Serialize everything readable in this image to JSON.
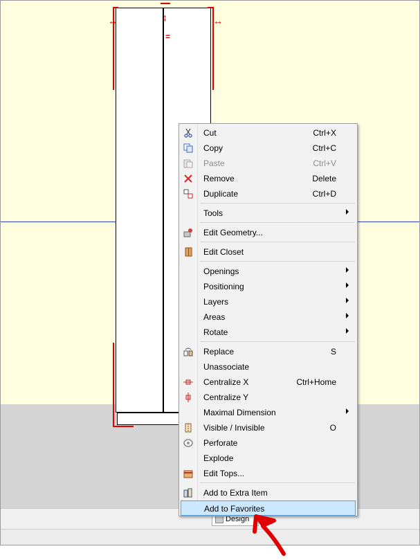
{
  "status": {
    "design_tab_label": "Design"
  },
  "menu": {
    "items": [
      {
        "id": "cut",
        "label": "Cut",
        "shortcut": "Ctrl+X",
        "icon": "scissors-icon"
      },
      {
        "id": "copy",
        "label": "Copy",
        "shortcut": "Ctrl+C",
        "icon": "copy-icon"
      },
      {
        "id": "paste",
        "label": "Paste",
        "shortcut": "Ctrl+V",
        "icon": "paste-icon",
        "disabled": true
      },
      {
        "id": "remove",
        "label": "Remove",
        "shortcut": "Delete",
        "icon": "remove-icon"
      },
      {
        "id": "duplicate",
        "label": "Duplicate",
        "shortcut": "Ctrl+D",
        "icon": "duplicate-icon"
      },
      {
        "id": "tools",
        "label": "Tools",
        "submenu": true
      },
      {
        "id": "edit_geometry",
        "label": "Edit Geometry...",
        "icon": "edit-geometry-icon"
      },
      {
        "id": "edit_closet",
        "label": "Edit Closet",
        "icon": "closet-icon"
      },
      {
        "id": "openings",
        "label": "Openings",
        "submenu": true
      },
      {
        "id": "positioning",
        "label": "Positioning",
        "submenu": true
      },
      {
        "id": "layers",
        "label": "Layers",
        "submenu": true
      },
      {
        "id": "areas",
        "label": "Areas",
        "submenu": true
      },
      {
        "id": "rotate",
        "label": "Rotate",
        "submenu": true
      },
      {
        "id": "replace",
        "label": "Replace",
        "shortcut": "S",
        "icon": "replace-icon"
      },
      {
        "id": "unassociate",
        "label": "Unassociate"
      },
      {
        "id": "centralize_x",
        "label": "Centralize X",
        "shortcut": "Ctrl+Home",
        "icon": "centralize-x-icon"
      },
      {
        "id": "centralize_y",
        "label": "Centralize Y",
        "icon": "centralize-y-icon"
      },
      {
        "id": "maximal_dimension",
        "label": "Maximal Dimension",
        "submenu": true
      },
      {
        "id": "visible_invisible",
        "label": "Visible / Invisible",
        "shortcut": "O",
        "icon": "visibility-icon"
      },
      {
        "id": "perforate",
        "label": "Perforate",
        "icon": "perforate-icon"
      },
      {
        "id": "explode",
        "label": "Explode"
      },
      {
        "id": "edit_tops",
        "label": "Edit Tops...",
        "icon": "edit-tops-icon"
      },
      {
        "id": "add_extra_item",
        "label": "Add to Extra Item",
        "icon": "extra-item-icon"
      },
      {
        "id": "add_favorites",
        "label": "Add to Favorites",
        "highlighted": true
      }
    ]
  },
  "colors": {
    "canvas": "#ffffe0",
    "selection": "#e00000",
    "highlight": "#cce8ff"
  }
}
